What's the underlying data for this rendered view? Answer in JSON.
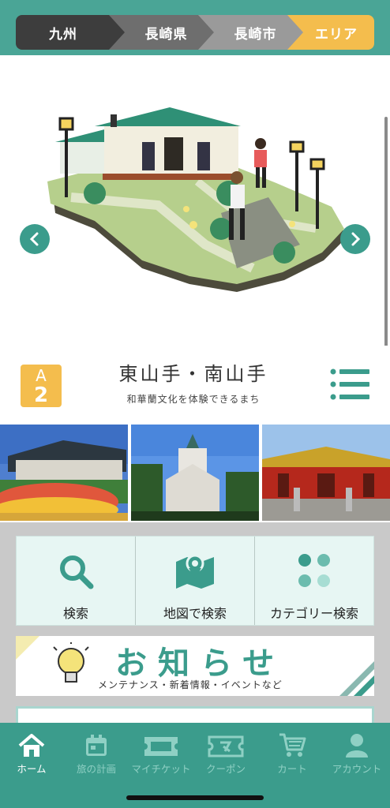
{
  "breadcrumb": [
    "九州",
    "長崎県",
    "長崎市",
    "エリア"
  ],
  "area": {
    "badge_letter": "A",
    "badge_number": "2",
    "title": "東山手・南山手",
    "subtitle": "和華蘭文化を体験できるまち"
  },
  "search": {
    "keyword_label": "検索",
    "map_label": "地図で検索",
    "category_label": "カテゴリー検索"
  },
  "news": {
    "title": "お知らせ",
    "subtitle": "メンテナンス・新着情報・イベントなど"
  },
  "tabs": [
    {
      "label": "ホーム",
      "icon": "home-icon"
    },
    {
      "label": "旅の計画",
      "icon": "calendar-icon"
    },
    {
      "label": "マイチケット",
      "icon": "ticket-icon"
    },
    {
      "label": "クーポン",
      "icon": "coupon-icon"
    },
    {
      "label": "カート",
      "icon": "cart-icon"
    },
    {
      "label": "アカウント",
      "icon": "account-icon"
    }
  ],
  "colors": {
    "primary": "#3b9c8c",
    "accent": "#f4bd4d",
    "light": "#e7f6f3"
  }
}
